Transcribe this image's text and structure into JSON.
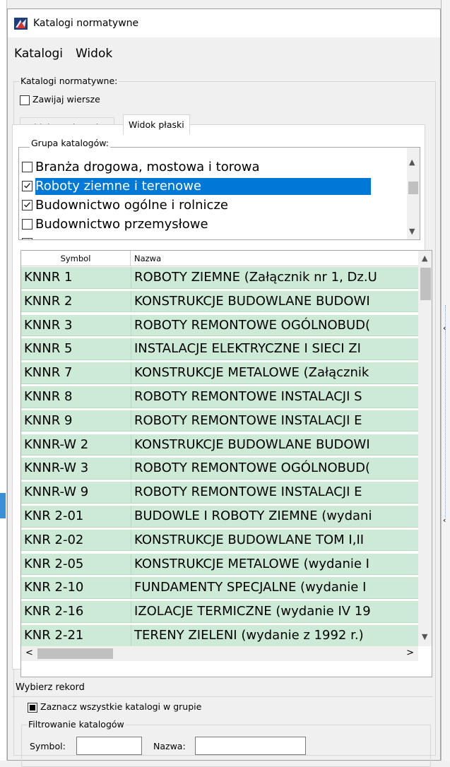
{
  "window": {
    "title": "Katalogi normatywne",
    "menu": [
      "Katalogi",
      "Widok"
    ]
  },
  "section": {
    "label": "Katalogi normatywne:",
    "wrap_rows_label": "Zawijaj wiersze",
    "wrap_rows_checked": false
  },
  "tabs": [
    {
      "label": "Widok strukturalny",
      "active": false
    },
    {
      "label": "Widok płaski",
      "active": true
    }
  ],
  "catalog_group": {
    "label": "Grupa katalogów:",
    "items": [
      {
        "label": "Branża drogowa, mostowa i torowa",
        "checked": false,
        "selected": false
      },
      {
        "label": "Roboty ziemne i terenowe",
        "checked": true,
        "selected": true
      },
      {
        "label": "Budownictwo ogólne i rolnicze",
        "checked": true,
        "selected": false
      },
      {
        "label": "Budownictwo przemysłowe",
        "checked": false,
        "selected": false
      }
    ]
  },
  "table": {
    "columns": [
      "Symbol",
      "Nazwa"
    ],
    "rows": [
      {
        "symbol": "KNNR 1",
        "name": "ROBOTY ZIEMNE (Załącznik nr 1, Dz.U"
      },
      {
        "symbol": "KNNR 2",
        "name": "KONSTRUKCJE BUDOWLANE BUDOWI"
      },
      {
        "symbol": "KNNR 3",
        "name": "ROBOTY REMONTOWE OGÓLNOBUD("
      },
      {
        "symbol": "KNNR 5",
        "name": "INSTALACJE ELEKTRYCZNE I SIECI ZI"
      },
      {
        "symbol": "KNNR 7",
        "name": "KONSTRUKCJE METALOWE (Załącznik"
      },
      {
        "symbol": "KNNR 8",
        "name": "ROBOTY REMONTOWE INSTALACJI S"
      },
      {
        "symbol": "KNNR 9",
        "name": "ROBOTY REMONTOWE INSTALACJI E"
      },
      {
        "symbol": "KNNR-W 2",
        "name": "KONSTRUKCJE BUDOWLANE BUDOWI"
      },
      {
        "symbol": "KNNR-W 3",
        "name": "ROBOTY REMONTOWE OGÓLNOBUD("
      },
      {
        "symbol": "KNNR-W 9",
        "name": "ROBOTY REMONTOWE INSTALACJI E"
      },
      {
        "symbol": "KNR 2-01",
        "name": "BUDOWLE I ROBOTY ZIEMNE (wydani"
      },
      {
        "symbol": "KNR 2-02",
        "name": "KONSTRUKCJE BUDOWLANE TOM I,II"
      },
      {
        "symbol": "KNR 2-05",
        "name": "KONSTRUKCJE METALOWE (wydanie I"
      },
      {
        "symbol": "KNR 2-10",
        "name": "FUNDAMENTY SPECJALNE (wydanie I"
      },
      {
        "symbol": "KNR 2-16",
        "name": "IZOLACJE TERMICZNE (wydanie IV 19"
      },
      {
        "symbol": "KNR 2-21",
        "name": "TERENY ZIELENI (wydanie z 1992 r.)"
      }
    ]
  },
  "status": {
    "label": "Wybierz rekord"
  },
  "select_all": {
    "label": "Zaznacz wszystkie katalogi w grupie",
    "state": "indeterminate"
  },
  "filter": {
    "label": "Filtrowanie katalogów",
    "symbol_label": "Symbol:",
    "symbol_value": "",
    "name_label": "Nazwa:",
    "name_value": ""
  },
  "colors": {
    "row_bg": "#ccead6",
    "selection": "#0078d7"
  }
}
